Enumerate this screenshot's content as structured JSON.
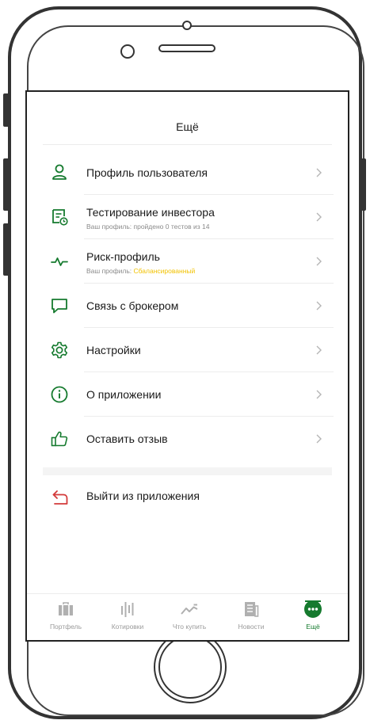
{
  "header": {
    "title": "Ещё"
  },
  "menu": {
    "items": [
      {
        "label": "Профиль пользователя",
        "icon": "user-icon"
      },
      {
        "label": "Тестирование инвестора",
        "sub": "Ваш профиль: пройдено 0 тестов из 14",
        "icon": "test-document-icon"
      },
      {
        "label": "Риск-профиль",
        "sub_prefix": "Ваш профиль: ",
        "sub_highlight": "Сбалансированный",
        "icon": "pulse-icon"
      },
      {
        "label": "Связь с брокером",
        "icon": "chat-bubble-icon"
      },
      {
        "label": "Настройки",
        "icon": "gear-icon"
      },
      {
        "label": "О приложении",
        "icon": "info-icon"
      },
      {
        "label": "Оставить отзыв",
        "icon": "thumbs-up-icon"
      }
    ]
  },
  "exit": {
    "label": "Выйти из приложения",
    "icon": "exit-arrow-icon"
  },
  "tabbar": {
    "tabs": [
      {
        "label": "Портфель",
        "icon": "briefcase-icon"
      },
      {
        "label": "Котировки",
        "icon": "quotes-bars-icon"
      },
      {
        "label": "Что купить",
        "icon": "trend-line-icon"
      },
      {
        "label": "Новости",
        "icon": "newspaper-icon"
      },
      {
        "label": "Ещё",
        "icon": "more-dots-icon",
        "active": true
      }
    ]
  },
  "colors": {
    "accent": "#157a2e",
    "highlight": "#f2c200",
    "exit": "#d33a3a",
    "tab_inactive": "#b0b0b0"
  }
}
